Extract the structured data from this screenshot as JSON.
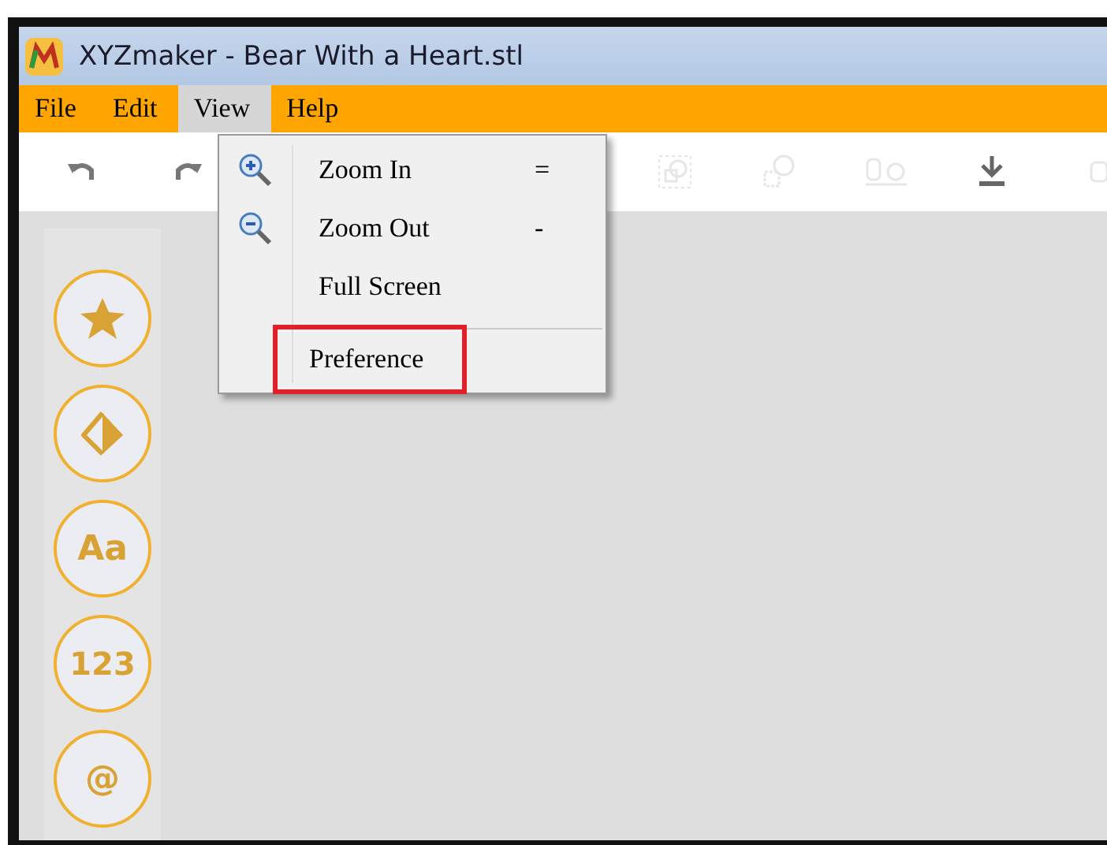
{
  "window": {
    "title": "XYZmaker - Bear With a Heart.stl"
  },
  "menu_bar": [
    {
      "label": "File",
      "selected": false
    },
    {
      "label": "Edit",
      "selected": false
    },
    {
      "label": "View",
      "selected": true
    },
    {
      "label": "Help",
      "selected": false
    }
  ],
  "toolbar": [
    {
      "kind": "undo",
      "disabled": false
    },
    {
      "kind": "redo",
      "disabled": false
    },
    {
      "kind": "group",
      "disabled": true
    },
    {
      "kind": "ungroup",
      "disabled": true
    },
    {
      "kind": "align",
      "disabled": true
    },
    {
      "kind": "download",
      "disabled": false
    },
    {
      "kind": "mirror",
      "disabled": true
    }
  ],
  "view_menu": [
    {
      "kind": "zoom_in",
      "label": "Zoom In",
      "shortcut": "=",
      "highlighted": false
    },
    {
      "kind": "zoom_out",
      "label": "Zoom Out",
      "shortcut": "-",
      "highlighted": false
    },
    {
      "kind": "item",
      "label": "Full Screen",
      "highlighted": false
    },
    {
      "kind": "separator"
    },
    {
      "kind": "item",
      "label": "Preference",
      "highlighted": true
    }
  ],
  "side_buttons": [
    {
      "kind": "star"
    },
    {
      "kind": "shape"
    },
    {
      "kind": "text",
      "label": "Aa"
    },
    {
      "kind": "text",
      "label": "123"
    },
    {
      "kind": "text",
      "label": "@"
    }
  ]
}
